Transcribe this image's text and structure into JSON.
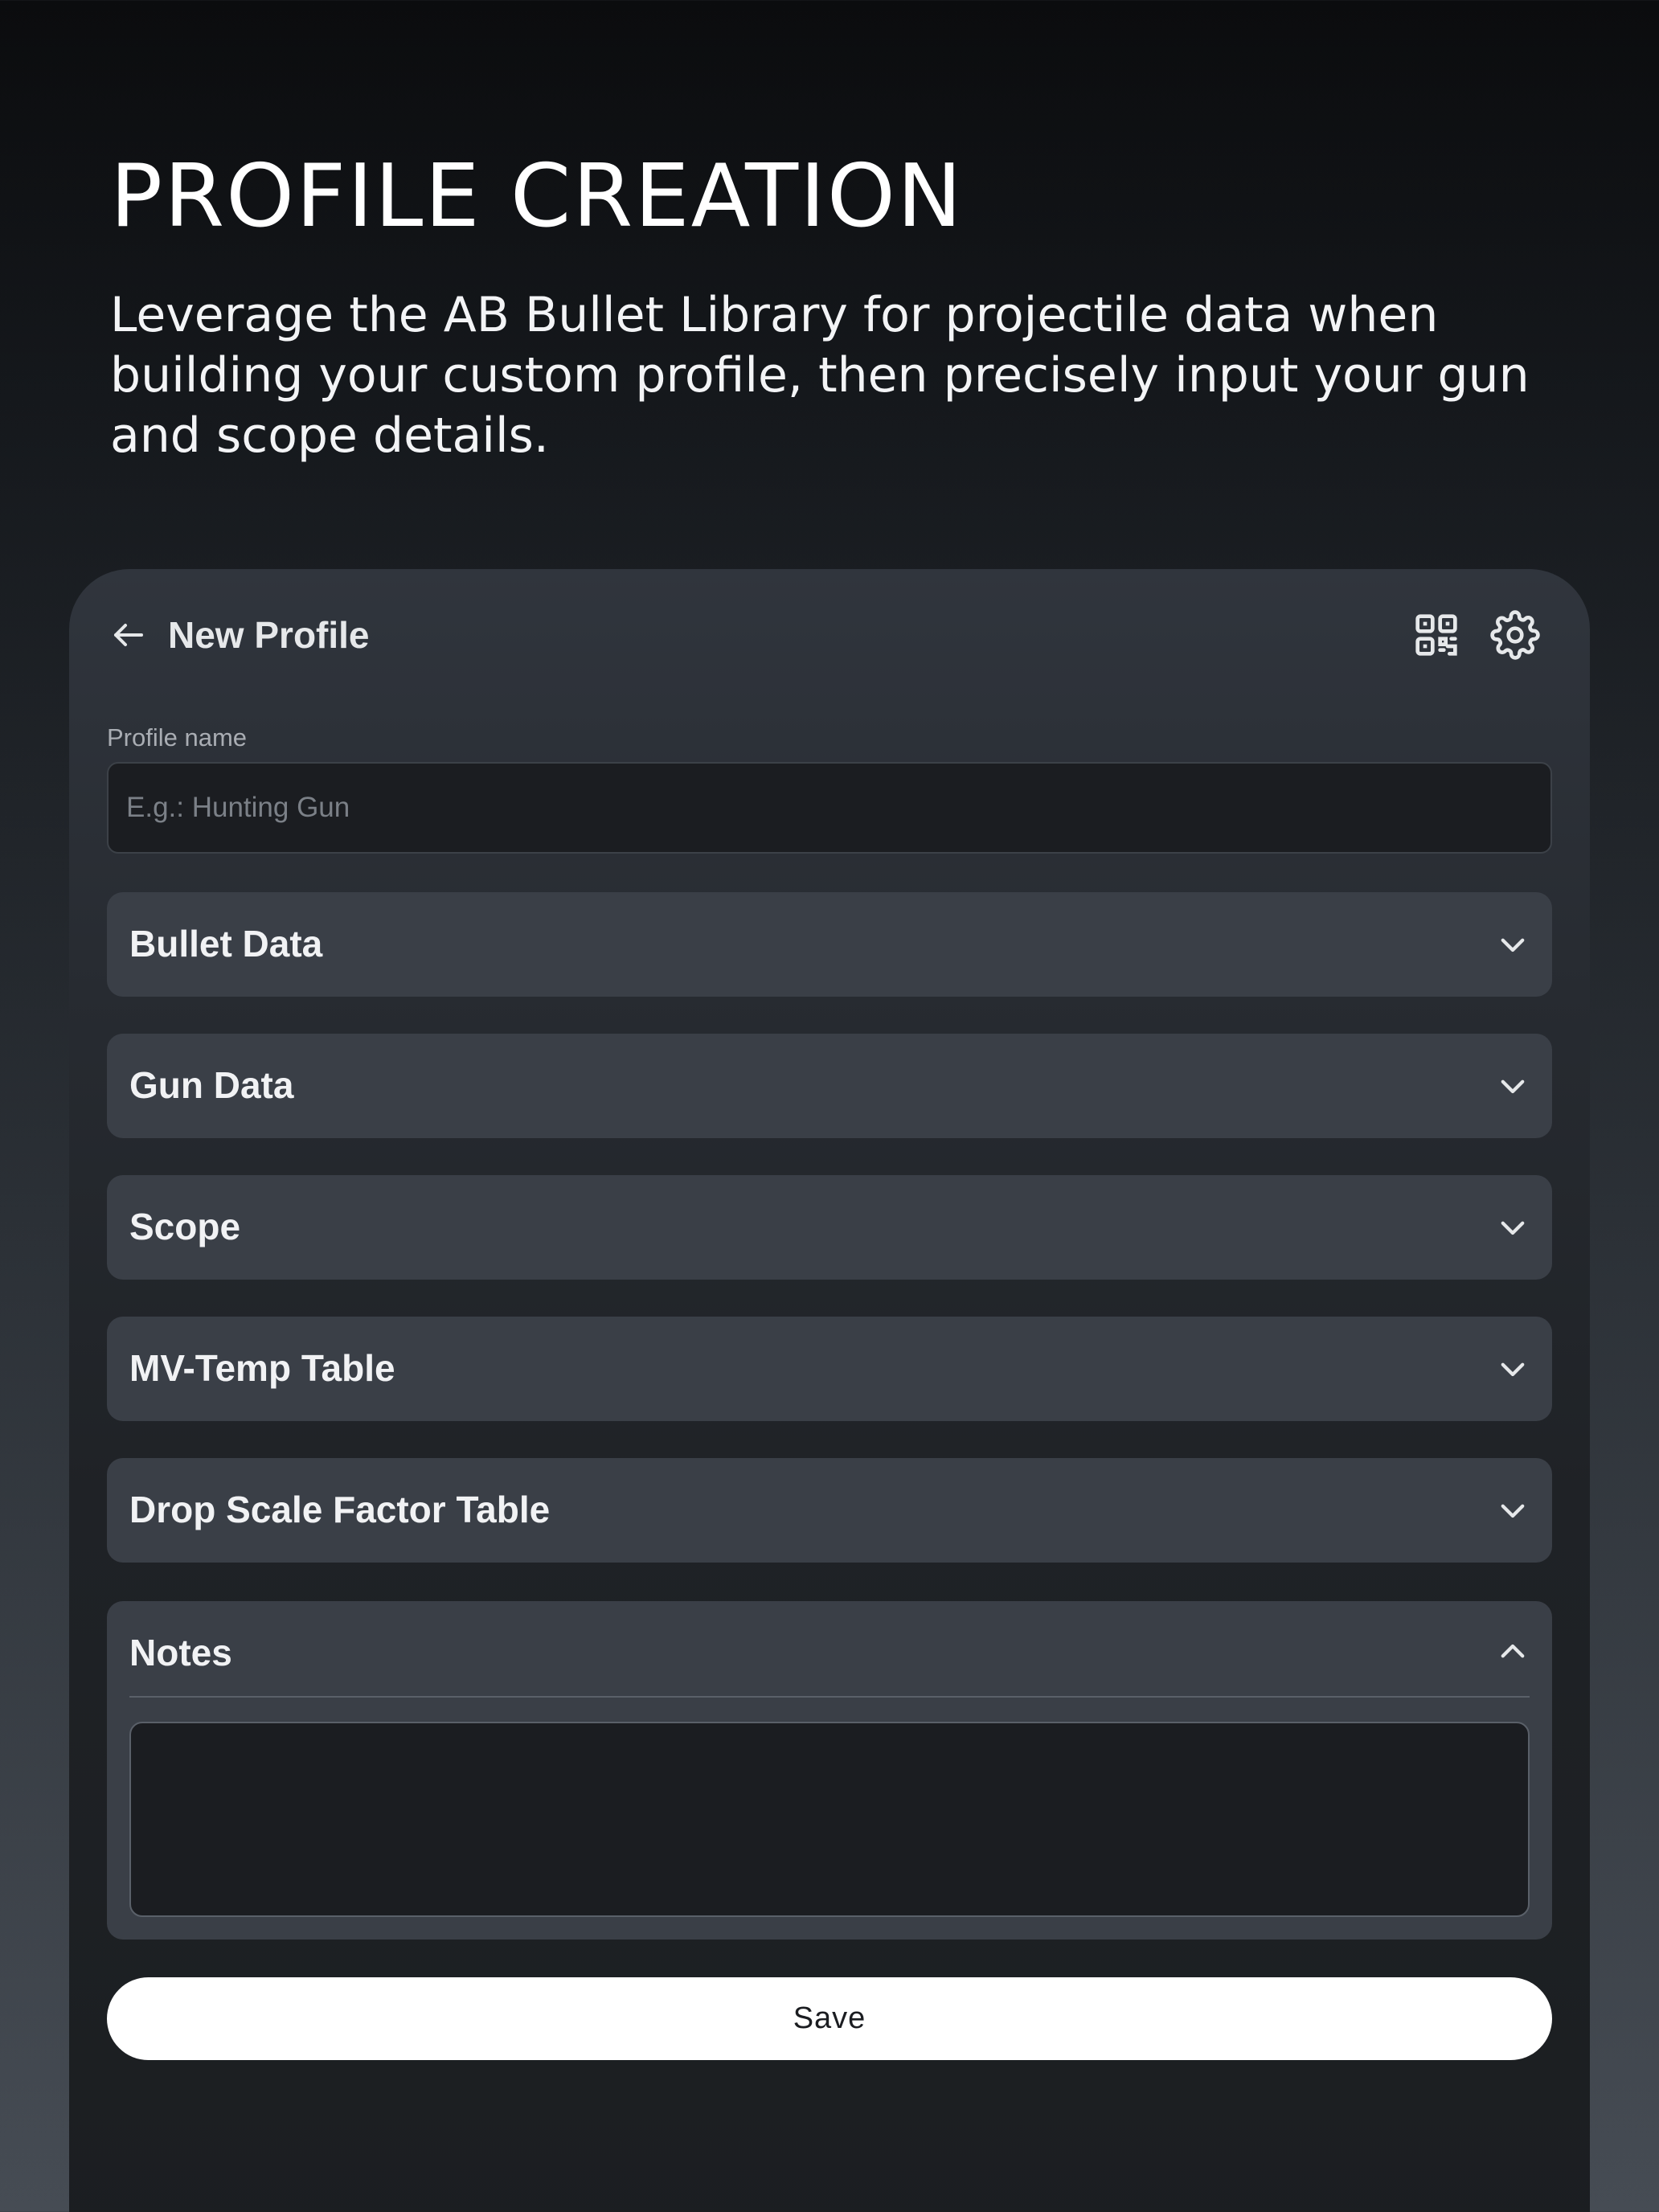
{
  "hero": {
    "title": "PROFILE CREATION",
    "description": "Leverage the AB Bullet Library for projectile data when building your custom profile, then precisely input your gun and scope details."
  },
  "header": {
    "back_icon": "arrow-left-icon",
    "title": "New Profile",
    "qr_icon": "qr-code-icon",
    "settings_icon": "gear-icon"
  },
  "profile_name": {
    "label": "Profile name",
    "value": "",
    "placeholder": "E.g.: Hunting Gun"
  },
  "sections": [
    {
      "title": "Bullet Data",
      "expanded": false,
      "icon": "chevron-down-icon"
    },
    {
      "title": "Gun Data",
      "expanded": false,
      "icon": "chevron-down-icon"
    },
    {
      "title": "Scope",
      "expanded": false,
      "icon": "chevron-down-icon"
    },
    {
      "title": "MV-Temp Table",
      "expanded": false,
      "icon": "chevron-down-icon"
    },
    {
      "title": "Drop Scale Factor Table",
      "expanded": false,
      "icon": "chevron-down-icon"
    }
  ],
  "notes": {
    "title": "Notes",
    "expanded": true,
    "icon": "chevron-up-icon",
    "value": ""
  },
  "actions": {
    "save_label": "Save"
  },
  "colors": {
    "panel": "#30353d",
    "section_bg": "#3a3f47",
    "input_bg": "#1b1d21",
    "text": "#ffffff",
    "muted": "#a9adb3",
    "button_bg": "#ffffff"
  }
}
